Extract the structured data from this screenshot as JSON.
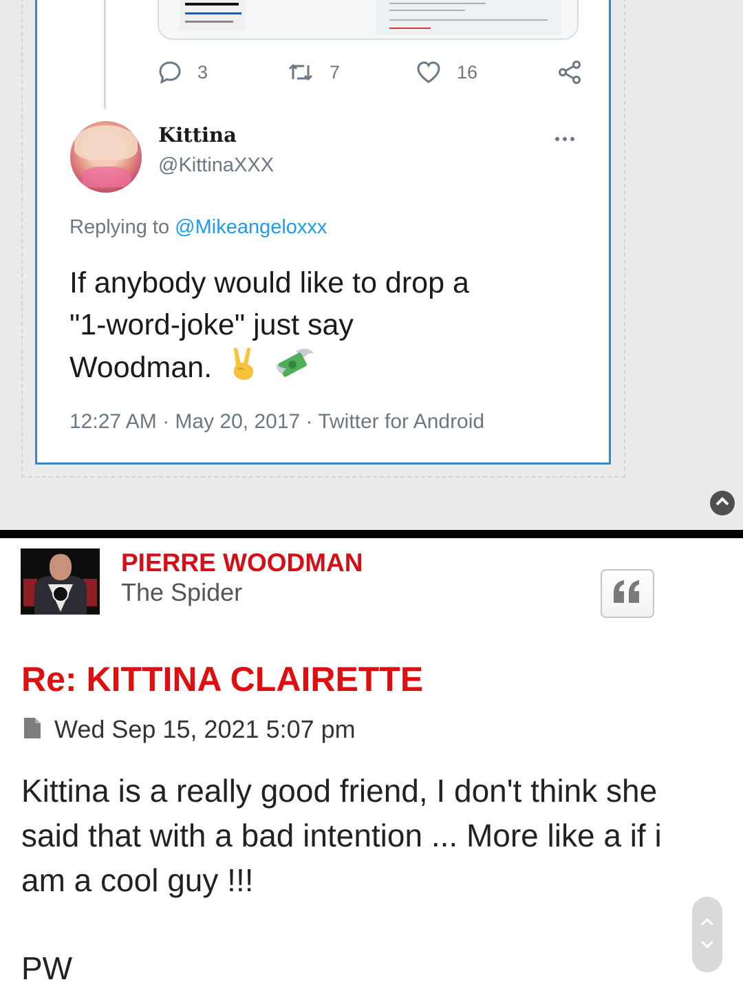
{
  "tweet": {
    "actions": {
      "reply_count": "3",
      "retweet_count": "7",
      "like_count": "16"
    },
    "author_name": "Kittina",
    "author_handle": "@KittinaXXX",
    "replying_prefix": "Replying to",
    "replying_mention": "@Mikeangeloxxx",
    "text_line1": "If anybody would like to drop a",
    "text_line2": "\"1-word-joke\" just say",
    "text_line3": "Woodman.",
    "emojis": [
      "victory-hand-icon",
      "money-with-wings-icon"
    ],
    "meta": "12:27 AM · May 20, 2017 · Twitter for Android"
  },
  "post": {
    "author": "PIERRE WOODMAN",
    "rank": "The Spider",
    "title": "Re: KITTINA CLAIRETTE",
    "date": "Wed Sep 15, 2021 5:07 pm",
    "body": "Kittina is a really good friend, I don't think she said that with a bad intention ... More like a if i am a cool guy !!!",
    "signature": "PW"
  },
  "colors": {
    "author_red": "#d31018",
    "title_red": "#e00f0f",
    "tweet_border": "#3d86c0",
    "mention_blue": "#1d9bf0"
  }
}
